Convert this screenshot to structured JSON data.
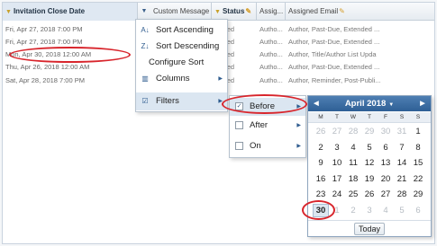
{
  "header": {
    "columns": [
      {
        "label": "Invitation Close Date",
        "filtered": true
      },
      {
        "label": "Custom Message",
        "filtered": false,
        "editable": true
      },
      {
        "label": "Status",
        "filtered": true,
        "editable": true
      },
      {
        "label": "Assig...",
        "filtered": false
      },
      {
        "label": "Assigned Email",
        "filtered": false,
        "editable": true
      }
    ],
    "menu_trigger_icon": "triangle-down-icon"
  },
  "rows": [
    {
      "date": "Fri, Apr 27, 2018 7:00 PM",
      "status": "Invited",
      "assigned": "Autho...",
      "email": "Author, Past-Due, Extended ..."
    },
    {
      "date": "Fri, Apr 27, 2018 7:00 PM",
      "status": "Invited",
      "assigned": "Autho...",
      "email": "Author, Past-Due, Extended ..."
    },
    {
      "date": "Mon, Apr 30, 2018 12:00 AM",
      "status": "Invited",
      "assigned": "Autho...",
      "email": "Author, Title/Author List Upda"
    },
    {
      "date": "Thu, Apr 26, 2018 12:00 AM",
      "status": "Invited",
      "assigned": "Autho...",
      "email": "Author, Past-Due, Extended ..."
    },
    {
      "date": "Sat, Apr 28, 2018 7:00 PM",
      "status": "Invited",
      "assigned": "Autho...",
      "email": "Author, Reminder, Post-Publi..."
    }
  ],
  "column_menu": {
    "items": [
      {
        "label": "Sort Ascending",
        "icon": "sort-ascending-icon"
      },
      {
        "label": "Sort Descending",
        "icon": "sort-descending-icon"
      },
      {
        "label": "Configure Sort",
        "icon": ""
      },
      {
        "label": "Columns",
        "icon": "columns-icon",
        "submenu": true
      },
      {
        "label": "Filters",
        "icon": "checkbox-checked-icon",
        "submenu": true,
        "checked": true
      }
    ]
  },
  "filter_menu": {
    "items": [
      {
        "label": "Before",
        "checked": true
      },
      {
        "label": "After",
        "checked": false
      },
      {
        "label": "On",
        "checked": false
      }
    ]
  },
  "date_picker": {
    "month_label": "April 2018",
    "weekdays": [
      "M",
      "T",
      "W",
      "T",
      "F",
      "S",
      "S"
    ],
    "weeks": [
      [
        {
          "d": "26",
          "o": true
        },
        {
          "d": "27",
          "o": true
        },
        {
          "d": "28",
          "o": true
        },
        {
          "d": "29",
          "o": true
        },
        {
          "d": "30",
          "o": true
        },
        {
          "d": "31",
          "o": true
        },
        {
          "d": "1",
          "o": false
        }
      ],
      [
        {
          "d": "2"
        },
        {
          "d": "3"
        },
        {
          "d": "4"
        },
        {
          "d": "5"
        },
        {
          "d": "6"
        },
        {
          "d": "7"
        },
        {
          "d": "8"
        }
      ],
      [
        {
          "d": "9"
        },
        {
          "d": "10"
        },
        {
          "d": "11"
        },
        {
          "d": "12"
        },
        {
          "d": "13"
        },
        {
          "d": "14"
        },
        {
          "d": "15"
        }
      ],
      [
        {
          "d": "16"
        },
        {
          "d": "17"
        },
        {
          "d": "18"
        },
        {
          "d": "19"
        },
        {
          "d": "20"
        },
        {
          "d": "21"
        },
        {
          "d": "22"
        }
      ],
      [
        {
          "d": "23"
        },
        {
          "d": "24"
        },
        {
          "d": "25"
        },
        {
          "d": "26"
        },
        {
          "d": "27"
        },
        {
          "d": "28"
        },
        {
          "d": "29"
        }
      ],
      [
        {
          "d": "30",
          "sel": true
        },
        {
          "d": "1",
          "o": true
        },
        {
          "d": "2",
          "o": true
        },
        {
          "d": "3",
          "o": true
        },
        {
          "d": "4",
          "o": true
        },
        {
          "d": "5",
          "o": true
        },
        {
          "d": "6",
          "o": true
        }
      ]
    ],
    "today_label": "Today"
  },
  "colors": {
    "annotation": "#d8252c",
    "picker_header": "#2e5f95",
    "menu_highlight": "#dbe6f1"
  }
}
